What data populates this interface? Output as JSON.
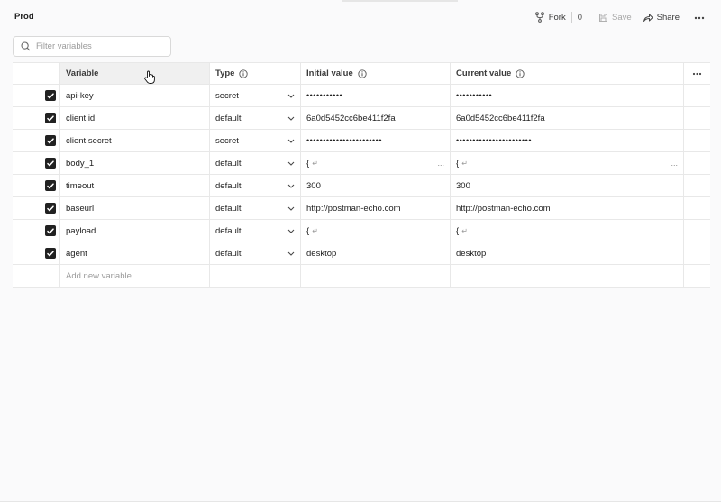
{
  "header": {
    "title": "Prod",
    "fork_label": "Fork",
    "fork_count": "0",
    "save_label": "Save",
    "share_label": "Share"
  },
  "search": {
    "placeholder": "Filter variables"
  },
  "table": {
    "columns": {
      "variable": "Variable",
      "type": "Type",
      "initial": "Initial value",
      "current": "Current value"
    },
    "rows": [
      {
        "checked": true,
        "name": "api-key",
        "type": "secret",
        "initial": "•••••••••••",
        "current": "•••••••••••"
      },
      {
        "checked": true,
        "name": "client id",
        "type": "default",
        "initial": "6a0d5452cc6be411f2fa",
        "current": "6a0d5452cc6be411f2fa"
      },
      {
        "checked": true,
        "name": "client secret",
        "type": "secret",
        "initial": "•••••••••••••••••••••••",
        "current": "•••••••••••••••••••••••"
      },
      {
        "checked": true,
        "name": "body_1",
        "type": "default",
        "initial": "{",
        "current": "{"
      },
      {
        "checked": true,
        "name": "timeout",
        "type": "default",
        "initial": "300",
        "current": "300"
      },
      {
        "checked": true,
        "name": "baseurl",
        "type": "default",
        "initial": "http://postman-echo.com",
        "current": "http://postman-echo.com"
      },
      {
        "checked": true,
        "name": "payload",
        "type": "default",
        "initial": "{",
        "current": "{"
      },
      {
        "checked": true,
        "name": "agent",
        "type": "default",
        "initial": "desktop",
        "current": "desktop"
      }
    ],
    "add_placeholder": "Add new variable",
    "ellipsis": "...",
    "return_glyph": "↵"
  },
  "colors": {
    "accent": "#212121",
    "border": "#e8e8e8",
    "muted": "#9b9b9b"
  },
  "icons": [
    "fork-icon",
    "save-icon",
    "share-icon",
    "more-icon",
    "search-icon",
    "info-icon",
    "chevron-down-icon",
    "checkbox-icon",
    "hand-cursor-icon"
  ]
}
